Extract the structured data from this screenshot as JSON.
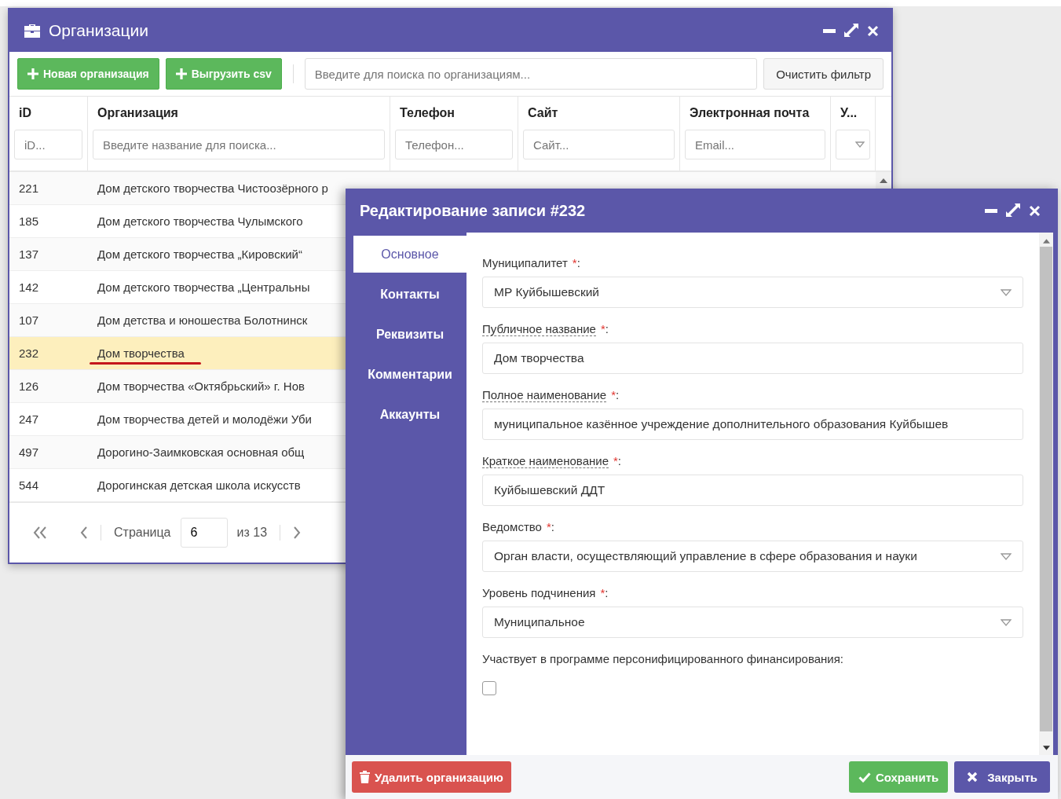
{
  "org_window": {
    "title": "Организации",
    "toolbar": {
      "buttons": [
        "Новая организация",
        "Выгрузить csv"
      ],
      "search": {
        "placeholder": "Введите для поиска по организациям..."
      },
      "clear_button": "Очистить фильтр"
    },
    "table": {
      "columns": [
        {
          "label": "iD",
          "filter": {
            "kind": "text",
            "placeholder": "iD..."
          }
        },
        {
          "label": "Организация",
          "filter": {
            "kind": "text",
            "placeholder": "Введите название для поиска..."
          }
        },
        {
          "label": "Телефон",
          "filter": {
            "kind": "text",
            "placeholder": "Телефон..."
          }
        },
        {
          "label": "Сайт",
          "filter": {
            "kind": "text",
            "placeholder": "Сайт..."
          }
        },
        {
          "label": "Электронная почта",
          "filter": {
            "kind": "text",
            "placeholder": "Email..."
          }
        },
        {
          "label": "У...",
          "filter": {
            "kind": "select"
          }
        }
      ],
      "rows": [
        {
          "id": "221",
          "organization": "Дом детского творчества Чистоозёрного р",
          "selected": false,
          "marked": false
        },
        {
          "id": "185",
          "organization": "Дом детского творчества Чулымского",
          "selected": false,
          "marked": false
        },
        {
          "id": "137",
          "organization": "Дом детского творчества „Кировский“",
          "selected": false,
          "marked": false
        },
        {
          "id": "142",
          "organization": "Дом детского творчества „Центральны",
          "selected": false,
          "marked": false
        },
        {
          "id": "107",
          "organization": "Дом детства и юношества Болотнинск",
          "selected": false,
          "marked": false
        },
        {
          "id": "232",
          "organization": "Дом творчества",
          "selected": true,
          "marked": true
        },
        {
          "id": "126",
          "organization": "Дом творчества «Октябрьский» г. Нов",
          "selected": false,
          "marked": false
        },
        {
          "id": "247",
          "organization": "Дом творчества детей и молодёжи Уби",
          "selected": false,
          "marked": false
        },
        {
          "id": "497",
          "organization": "Дорогино-Заимковская основная общ",
          "selected": false,
          "marked": false
        },
        {
          "id": "544",
          "organization": "Дорогинская детская школа искусств",
          "selected": false,
          "marked": false
        }
      ]
    },
    "pagination": {
      "page_label": "Страница",
      "page": "6",
      "of_label": "из 13"
    }
  },
  "edit_dialog": {
    "title": "Редактирование записи #232",
    "tabs": [
      {
        "label": "Основное",
        "selected": true
      },
      {
        "label": "Контакты",
        "selected": false
      },
      {
        "label": "Реквизиты",
        "selected": false
      },
      {
        "label": "Комментарии",
        "selected": false
      },
      {
        "label": "Аккаунты",
        "selected": false
      }
    ],
    "fields": [
      {
        "kind": "select",
        "label": "Муниципалитет",
        "hint": false,
        "required_mark": "*",
        "colon": ":",
        "value": "МР Куйбышевский"
      },
      {
        "kind": "text",
        "label": "Публичное название",
        "hint": true,
        "required_mark": "*",
        "colon": ":",
        "value": "Дом творчества"
      },
      {
        "kind": "text",
        "label": "Полное наименование",
        "hint": true,
        "required_mark": "*",
        "colon": ":",
        "value": "муниципальное казённое учреждение дополнительного образования Куйбышев"
      },
      {
        "kind": "text",
        "label": "Краткое наименование",
        "hint": true,
        "required_mark": "*",
        "colon": ":",
        "value": "Куйбышевский ДДТ"
      },
      {
        "kind": "select",
        "label": "Ведомство",
        "hint": false,
        "required_mark": "*",
        "colon": ":",
        "value": "Орган власти, осуществляющий управление в сфере образования и науки"
      },
      {
        "kind": "select",
        "label": "Уровень подчинения",
        "hint": false,
        "required_mark": "*",
        "colon": ":",
        "value": "Муниципальное"
      }
    ],
    "checkbox": {
      "label": "Участвует в программе персонифицированного финансирования:",
      "checked": false
    },
    "delete_button": "Удалить организацию",
    "save_button": "Сохранить",
    "close_button": "Закрыть"
  }
}
